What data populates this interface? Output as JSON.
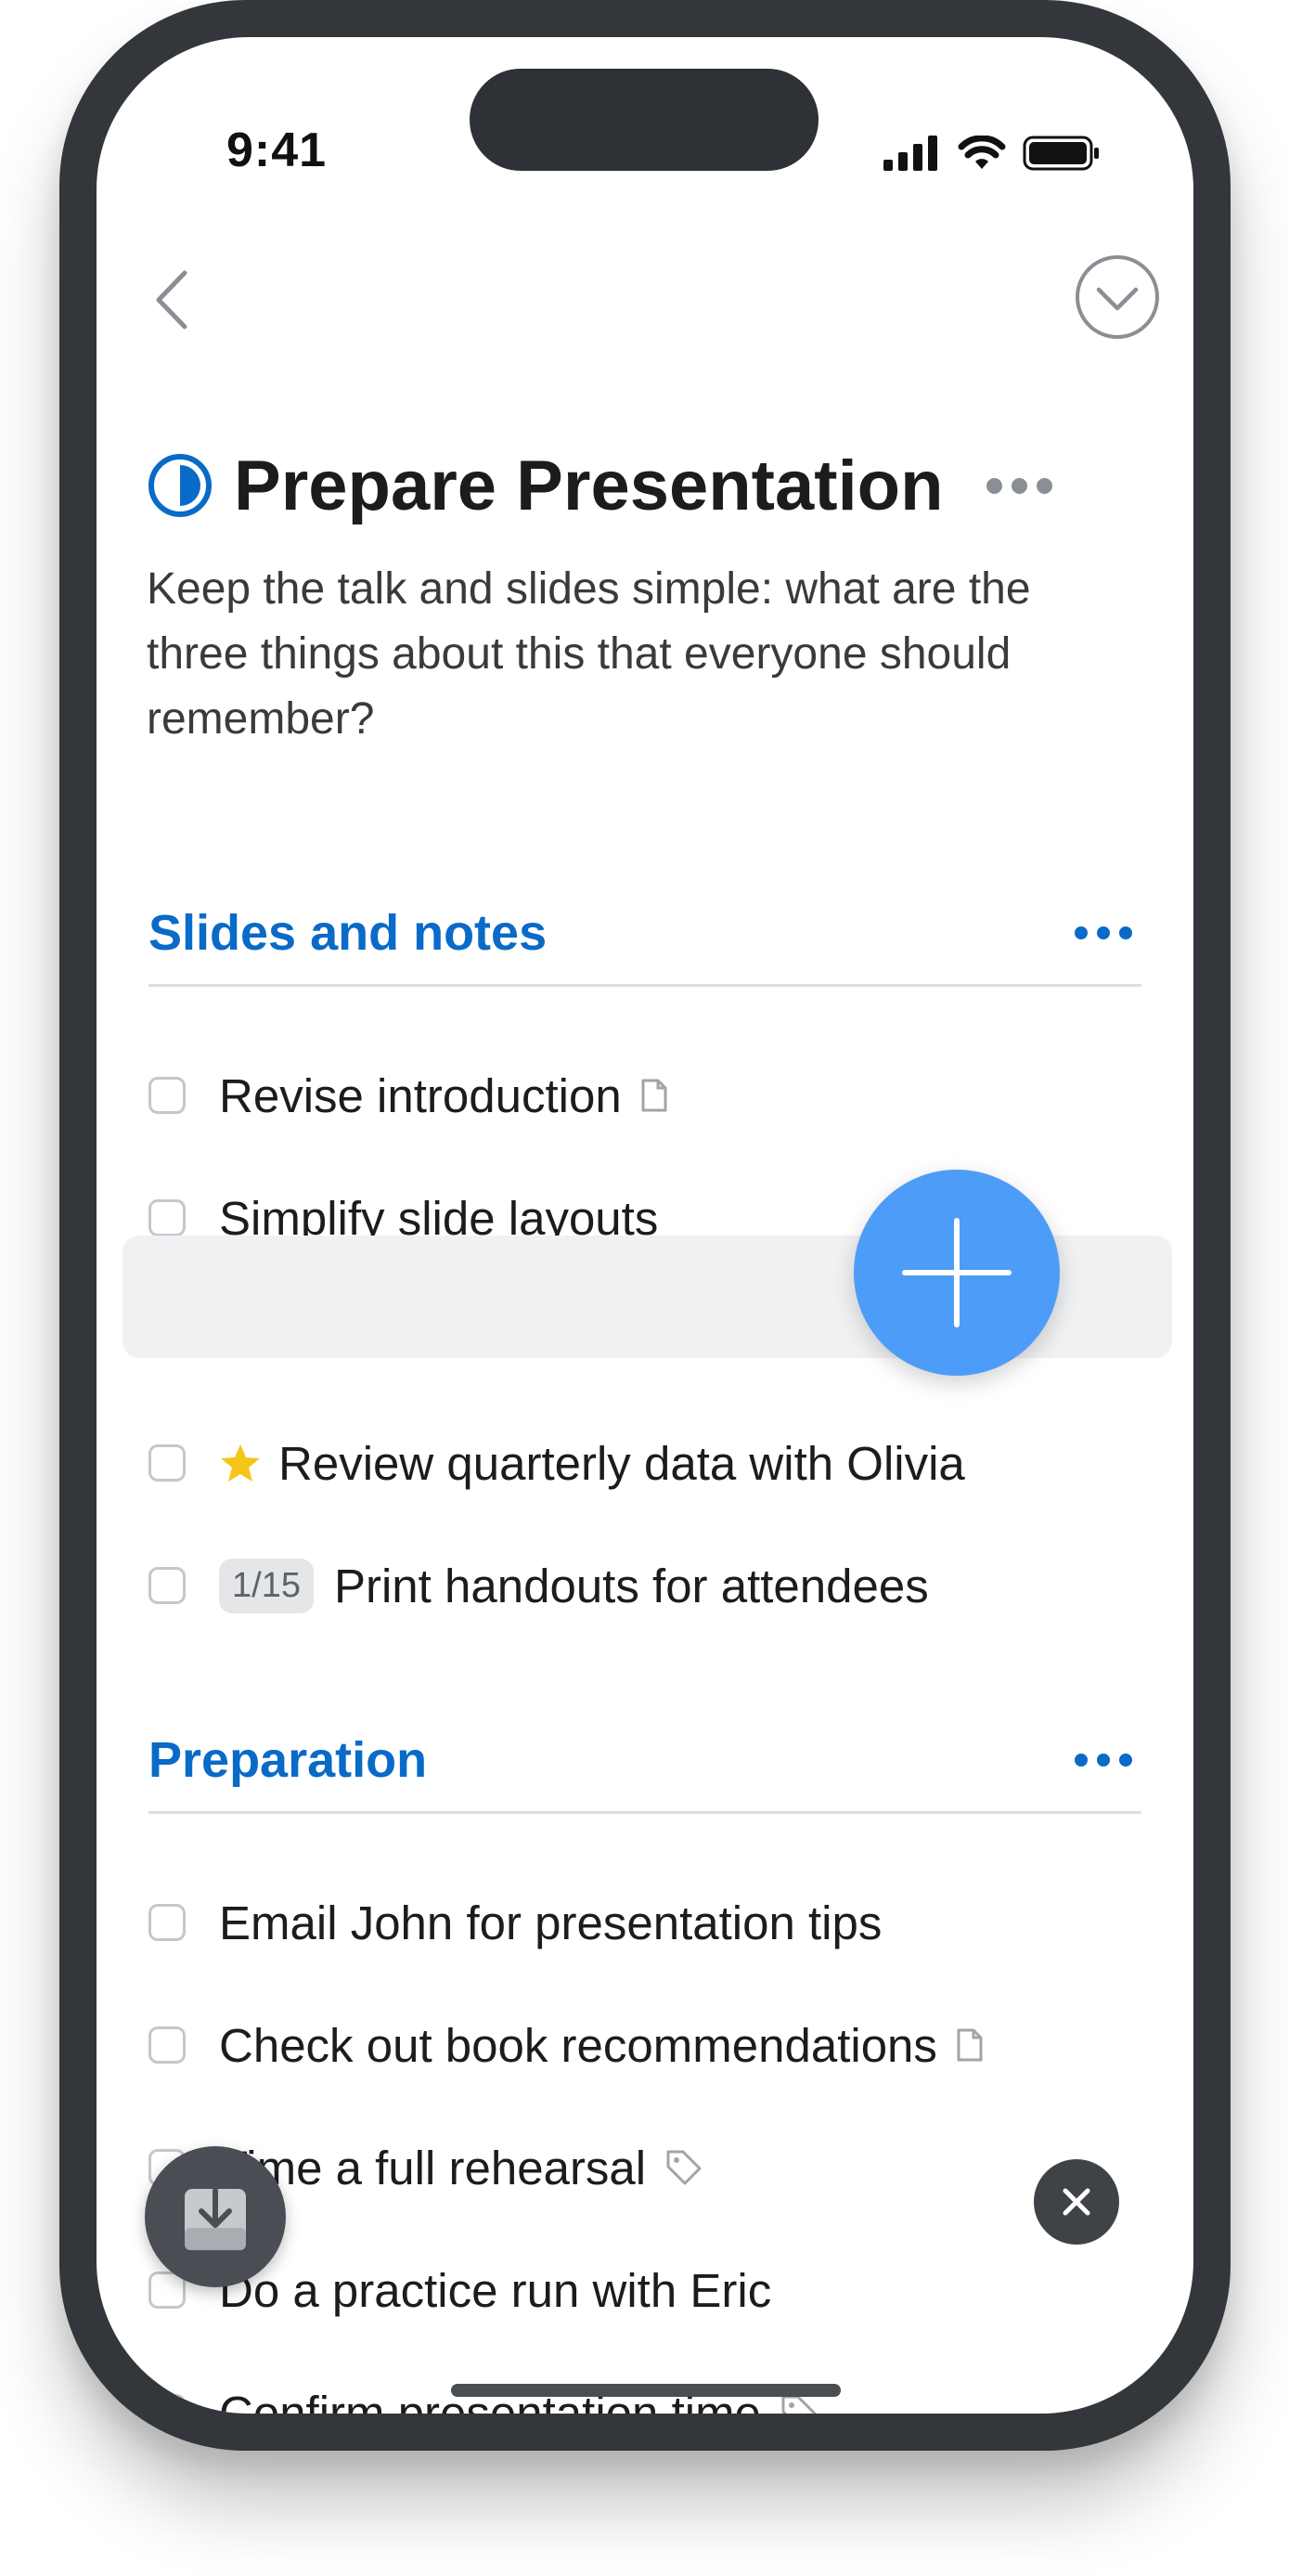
{
  "status_bar": {
    "time": "9:41"
  },
  "project": {
    "title": "Prepare Presentation",
    "notes": "Keep the talk and slides simple: what are the three things about this that everyone should remember?"
  },
  "sections": [
    {
      "title": "Slides and notes",
      "items": [
        {
          "label": "Revise introduction",
          "meta_icon": "note-icon"
        },
        {
          "label": "Simplify slide layouts"
        },
        {
          "label": "Review quarterly data with Olivia",
          "prefix_icon": "star-icon"
        },
        {
          "label": "Print handouts for attendees",
          "badge": "1/15"
        }
      ]
    },
    {
      "title": "Preparation",
      "items": [
        {
          "label": "Email John for presentation tips"
        },
        {
          "label": "Check out book recommendations",
          "meta_icon": "note-icon"
        },
        {
          "label": "Time a full rehearsal",
          "meta_icon": "tag-icon"
        },
        {
          "label": "Do a practice run with Eric"
        },
        {
          "label": "Confirm presentation time",
          "meta_icon": "tag-icon"
        }
      ]
    }
  ],
  "colors": {
    "accent": "#0a6ac7",
    "fab": "#4d9cf8",
    "star": "#f5c518"
  }
}
